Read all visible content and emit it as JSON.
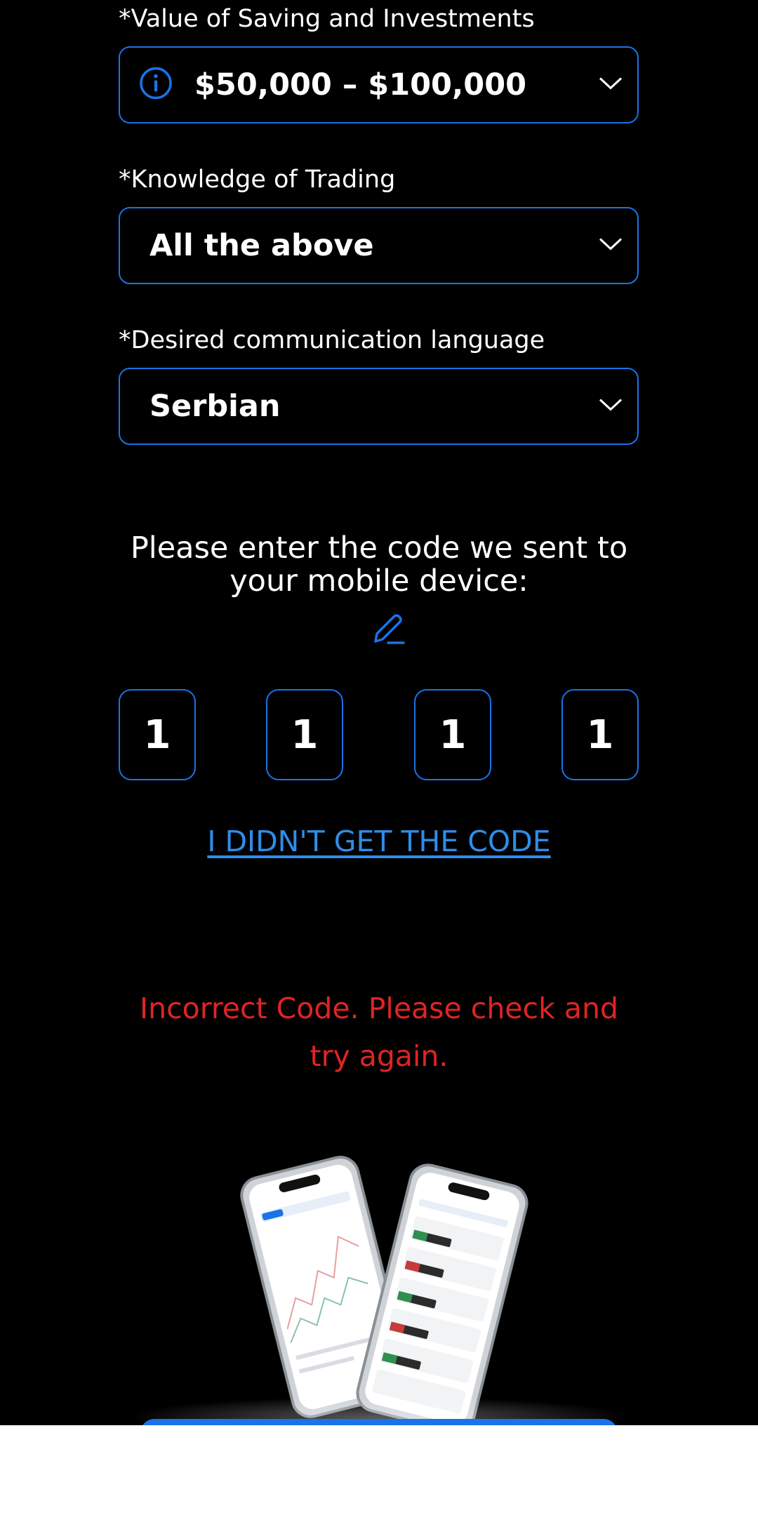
{
  "form": {
    "savings": {
      "label": "*Value of Saving and Investments",
      "value": "$50,000 – $100,000"
    },
    "knowledge": {
      "label": "*Knowledge of Trading",
      "value": "All the above"
    },
    "language": {
      "label": "*Desired communication language",
      "value": "Serbian"
    }
  },
  "verification": {
    "prompt": "Please enter the code we sent to your mobile device:",
    "digits": [
      "1",
      "1",
      "1",
      "1"
    ],
    "resend_link": "I DIDN'T GET THE CODE",
    "error": "Incorrect Code. Please check and try again."
  },
  "colors": {
    "background": "#000000",
    "accent": "#1a73e8",
    "link": "#2f8de8",
    "error": "#e02424"
  },
  "icons": [
    "info-icon",
    "chevron-down-icon",
    "pencil-icon"
  ]
}
